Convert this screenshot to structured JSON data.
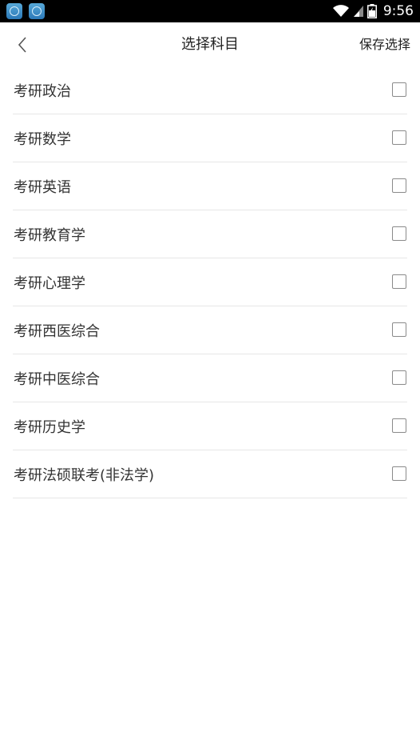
{
  "status_bar": {
    "time": "9:56",
    "icons": [
      "app-notification-icon",
      "app-notification-icon",
      "wifi-icon",
      "signal-icon",
      "battery-charging-icon"
    ]
  },
  "header": {
    "title": "选择科目",
    "back_icon": "chevron-left-icon",
    "save_label": "保存选择"
  },
  "subjects": [
    {
      "label": "考研政治",
      "checked": false
    },
    {
      "label": "考研数学",
      "checked": false
    },
    {
      "label": "考研英语",
      "checked": false
    },
    {
      "label": "考研教育学",
      "checked": false
    },
    {
      "label": "考研心理学",
      "checked": false
    },
    {
      "label": "考研西医综合",
      "checked": false
    },
    {
      "label": "考研中医综合",
      "checked": false
    },
    {
      "label": "考研历史学",
      "checked": false
    },
    {
      "label": "考研法硕联考(非法学)",
      "checked": false
    }
  ],
  "colors": {
    "status_bar_bg": "#000000",
    "background": "#ffffff",
    "text": "#333333",
    "divider": "#e6e6e6",
    "checkbox_border": "#8a8a8a"
  }
}
